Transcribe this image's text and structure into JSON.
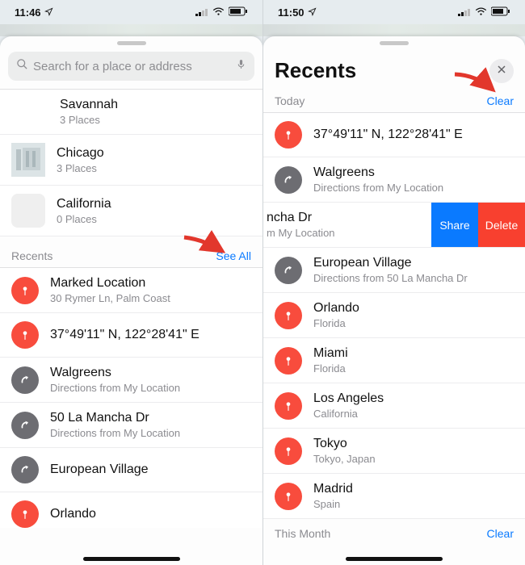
{
  "left": {
    "status_time": "11:46",
    "search_placeholder": "Search for a place or address",
    "guides": [
      {
        "title": "Savannah",
        "subtitle": "3 Places",
        "thumb": "none"
      },
      {
        "title": "Chicago",
        "subtitle": "3 Places",
        "thumb": "photo"
      },
      {
        "title": "California",
        "subtitle": "0 Places",
        "thumb": "blank"
      }
    ],
    "recents_header": "Recents",
    "see_all": "See All",
    "recents": [
      {
        "icon": "pin-red",
        "title": "Marked Location",
        "subtitle": "30 Rymer Ln, Palm Coast"
      },
      {
        "icon": "pin-red",
        "title": "37°49'11\" N, 122°28'41\" E",
        "subtitle": ""
      },
      {
        "icon": "dir-grey",
        "title": "Walgreens",
        "subtitle": "Directions from My Location"
      },
      {
        "icon": "dir-grey",
        "title": "50 La Mancha Dr",
        "subtitle": "Directions from My Location"
      },
      {
        "icon": "dir-grey",
        "title": "European Village",
        "subtitle": "…"
      },
      {
        "icon": "pin-red",
        "title": "Orlando",
        "subtitle": ""
      }
    ]
  },
  "right": {
    "status_time": "11:50",
    "title": "Recents",
    "today_label": "Today",
    "clear_label": "Clear",
    "rows": [
      {
        "icon": "pin-red",
        "title": "37°49'11\" N, 122°28'41\" E",
        "subtitle": ""
      },
      {
        "icon": "dir-grey",
        "title": "Walgreens",
        "subtitle": "Directions from My Location"
      }
    ],
    "swiped": {
      "title": "ncha Dr",
      "subtitle": "m My Location",
      "share": "Share",
      "delete": "Delete"
    },
    "rows2": [
      {
        "icon": "dir-grey",
        "title": "European Village",
        "subtitle": "Directions from 50 La Mancha Dr"
      },
      {
        "icon": "pin-red",
        "title": "Orlando",
        "subtitle": "Florida"
      },
      {
        "icon": "pin-red",
        "title": "Miami",
        "subtitle": "Florida"
      },
      {
        "icon": "pin-red",
        "title": "Los Angeles",
        "subtitle": "California"
      },
      {
        "icon": "pin-red",
        "title": "Tokyo",
        "subtitle": "Tokyo, Japan"
      },
      {
        "icon": "pin-red",
        "title": "Madrid",
        "subtitle": "Spain"
      }
    ],
    "this_month_label": "This Month",
    "clear_label2": "Clear"
  },
  "status_icons": {
    "signal": "▮",
    "wifi": "▲",
    "battery": "■"
  }
}
